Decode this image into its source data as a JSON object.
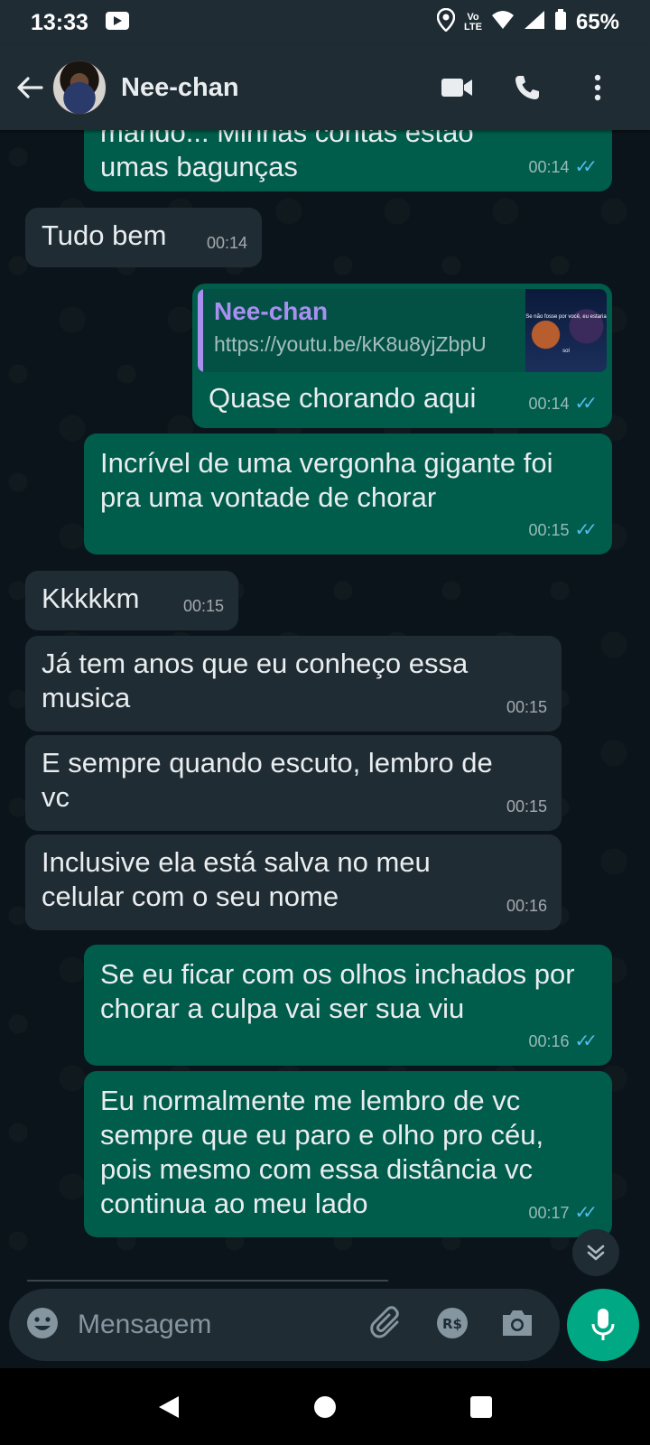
{
  "status_bar": {
    "time": "13:33",
    "volte_top": "Vo",
    "volte_bottom": "LTE",
    "battery": "65%"
  },
  "header": {
    "contact_name": "Nee-chan"
  },
  "messages": [
    {
      "dir": "out",
      "lines": [
        "mando... Minhas contas estão",
        "umas bagunças"
      ],
      "time": "00:14",
      "read": true
    },
    {
      "dir": "in",
      "text": "Tudo bem",
      "time": "00:14"
    },
    {
      "dir": "out",
      "quote_name": "Nee-chan",
      "quote_link": "https://youtu.be/kK8u8yjZbpU",
      "quote_thumb_text": "Se não fosse por você, eu estaria sol",
      "text": "Quase chorando aqui",
      "time": "00:14",
      "read": true
    },
    {
      "dir": "out",
      "text": "Incrível de uma vergonha gigante foi pra uma vontade de chorar",
      "time": "00:15",
      "read": true
    },
    {
      "dir": "in",
      "text": "Kkkkkm",
      "time": "00:15"
    },
    {
      "dir": "in",
      "text": "Já tem anos que eu conheço essa musica",
      "time": "00:15"
    },
    {
      "dir": "in",
      "text": "E sempre quando escuto, lembro de vc",
      "time": "00:15"
    },
    {
      "dir": "in",
      "text": "Inclusive ela está salva no meu celular com o seu nome",
      "time": "00:16"
    },
    {
      "dir": "out",
      "text": "Se eu ficar com os olhos inchados por chorar a culpa vai ser sua viu",
      "time": "00:16",
      "read": true
    },
    {
      "dir": "out",
      "text": "Eu normalmente me lembro de vc sempre que eu paro e olho pro céu, pois mesmo com essa distância vc continua ao meu lado",
      "time": "00:17",
      "read": true
    }
  ],
  "composer": {
    "placeholder": "Mensagem",
    "currency_label": "R$"
  },
  "ticks_glyph": "✓✓",
  "colors": {
    "outgoing_bubble": "#005c4b",
    "incoming_bubble": "#202c33",
    "accent": "#00a884",
    "read_ticks": "#53bdeb",
    "quote_name": "#a88ff0"
  }
}
